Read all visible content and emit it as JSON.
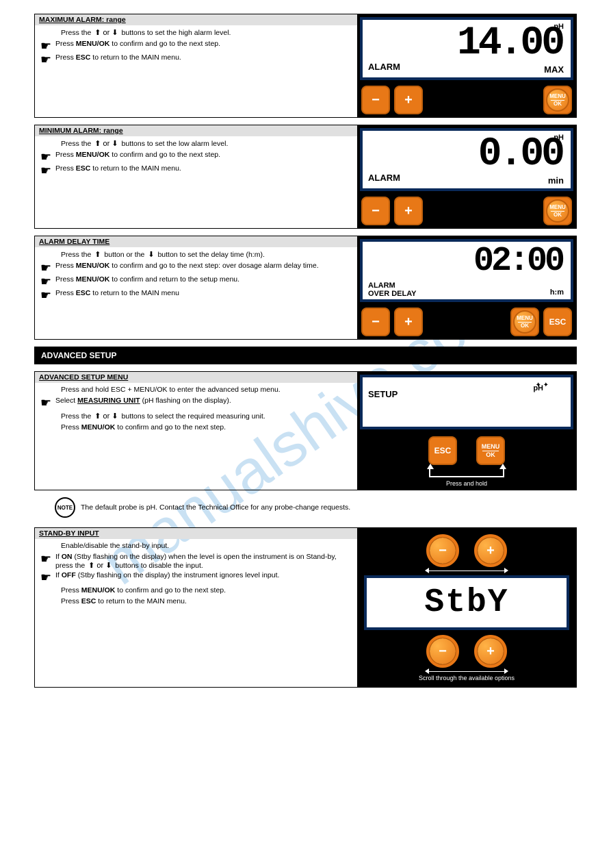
{
  "watermark": "manualshive.com",
  "box1": {
    "header": "MAXIMUM ALARM: range",
    "line1_pre": "Press the ",
    "line1_arrows": "⬆ or ⬇",
    "line1_post": " buttons to set the high alarm level.",
    "bullet1_pre": "Press ",
    "bullet1_bold": "MENU/OK",
    "bullet1_post": " to confirm and go to the next step.",
    "bullet2_pre": "Press ",
    "bullet2_bold": "ESC",
    "bullet2_post": " to return to the MAIN menu.",
    "lcd_value": "14.00",
    "lcd_unit": "pH",
    "lcd_left": "ALARM",
    "lcd_right": "MAX"
  },
  "box2": {
    "header": "MINIMUM ALARM: range",
    "line1_pre": "Press the ",
    "line1_arrows": "⬆ or ⬇",
    "line1_post": " buttons to set the low alarm level.",
    "bullet1_pre": "Press ",
    "bullet1_bold": "MENU/OK",
    "bullet1_post": " to confirm and go to the next step.",
    "bullet2_pre": "Press ",
    "bullet2_bold": "ESC",
    "bullet2_post": " to return to the MAIN menu.",
    "lcd_value": "0.00",
    "lcd_unit": "pH",
    "lcd_left": "ALARM",
    "lcd_right": "min"
  },
  "box3": {
    "header": "ALARM DELAY TIME",
    "line1_pre": "Press the ",
    "line1_arrows": "⬆",
    "line1_mid": " button or the ",
    "line1_arrows2": "⬇",
    "line1_post": " button to set the delay time (h:m).",
    "bullet1_pre": "Press ",
    "bullet1_bold": "MENU/OK",
    "bullet1_post": " to confirm and go to the next step: over dosage alarm delay time.",
    "bullet2_pre": "Press ",
    "bullet2_bold": "MENU/OK",
    "bullet2_post": " to confirm and return to the setup menu.",
    "bullet3_pre": "Press ",
    "bullet3_bold": "ESC",
    "bullet3_post": " to return to the MAIN menu",
    "lcd_value": "02:00",
    "lcd_unit_right": "h:m",
    "lcd_left1": "ALARM",
    "lcd_left2": "OVER   DELAY"
  },
  "divider": "ADVANCED SETUP",
  "box4": {
    "header": "ADVANCED SETUP MENU",
    "line1": "Press and hold ESC + MENU/OK to enter the advanced setup menu.",
    "bullet1_pre": "Select ",
    "bullet1_bold": "MEASURING UNIT",
    "bullet1_post": " (pH flashing on the display).",
    "line2_pre": "Press the ",
    "line2_arrows": "⬆ or ⬇",
    "line2_post": " buttons to select the required measuring unit.",
    "line3_pre": "Press ",
    "line3_bold": "MENU/OK",
    "line3_post": " to confirm and go to the next step.",
    "lcd_unit": "pH",
    "lcd_left": "SETUP",
    "btn_hint": "Press and hold"
  },
  "note": {
    "label": "NOTE",
    "text": "The default probe is pH. Contact the Technical Office for any probe-change requests."
  },
  "box5": {
    "header": "STAND-BY INPUT",
    "line1": "Enable/disable the stand-by input.",
    "bullet1_pre": "If ",
    "bullet1_bold": "ON",
    "bullet1_post": " (Stby flashing on the display) when the level is open the instrument is on Stand-by, press the ",
    "bullet1_arrows": "⬆ or ⬇",
    "bullet1_end": " buttons to disable the input.",
    "bullet2_pre": "If ",
    "bullet2_bold": "OFF",
    "bullet2_post": " (Stby flashing on the display) the instrument ignores level input.",
    "line3_pre": "Press ",
    "line3_bold": "MENU/OK",
    "line3_post": " to confirm and go to the next step.",
    "line4_pre": "Press ",
    "line4_bold": "ESC",
    "line4_post": " to return to the MAIN menu.",
    "lcd_value": "StbY",
    "toggle_hint": "Scroll through the available options"
  },
  "buttons": {
    "minus": "−",
    "plus": "+",
    "menu": "MENU",
    "ok": "OK",
    "esc": "ESC"
  }
}
